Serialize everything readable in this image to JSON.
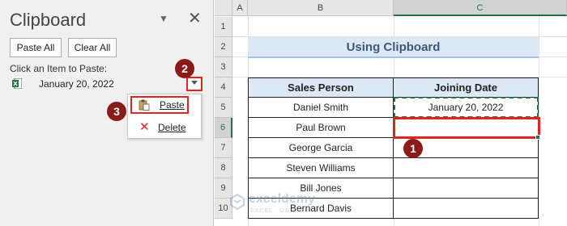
{
  "clipboard": {
    "title": "Clipboard",
    "options_glyph": "▼",
    "close_glyph": "✕",
    "paste_all_label": "Paste All",
    "clear_all_label": "Clear All",
    "hint": "Click an Item to Paste:",
    "items": [
      {
        "label": "January 20, 2022",
        "icon": "excel-icon"
      }
    ],
    "menu": {
      "paste_label": "Paste",
      "delete_label": "Delete",
      "delete_glyph": "✕"
    }
  },
  "badges": [
    "1",
    "2",
    "3"
  ],
  "sheet": {
    "columns": [
      "A",
      "B",
      "C"
    ],
    "rows": [
      "1",
      "2",
      "3",
      "4",
      "5",
      "6",
      "7",
      "8",
      "9",
      "10"
    ],
    "title": "Using Clipboard",
    "headers": [
      "Sales Person",
      "Joining Date"
    ],
    "data": [
      [
        "Daniel Smith",
        "January 20, 2022"
      ],
      [
        "Paul Brown",
        ""
      ],
      [
        "George Garcia",
        ""
      ],
      [
        "Steven Williams",
        ""
      ],
      [
        "Bill Jones",
        ""
      ],
      [
        "Bernard Davis",
        ""
      ]
    ]
  },
  "watermark": {
    "name": "exceldemy",
    "tagline": "EXCEL · DATA · BI"
  },
  "colors": {
    "accent_red": "#e3231d",
    "badge": "#8b1a1a",
    "excel_green": "#217346",
    "header_fill": "#dce9f5"
  }
}
